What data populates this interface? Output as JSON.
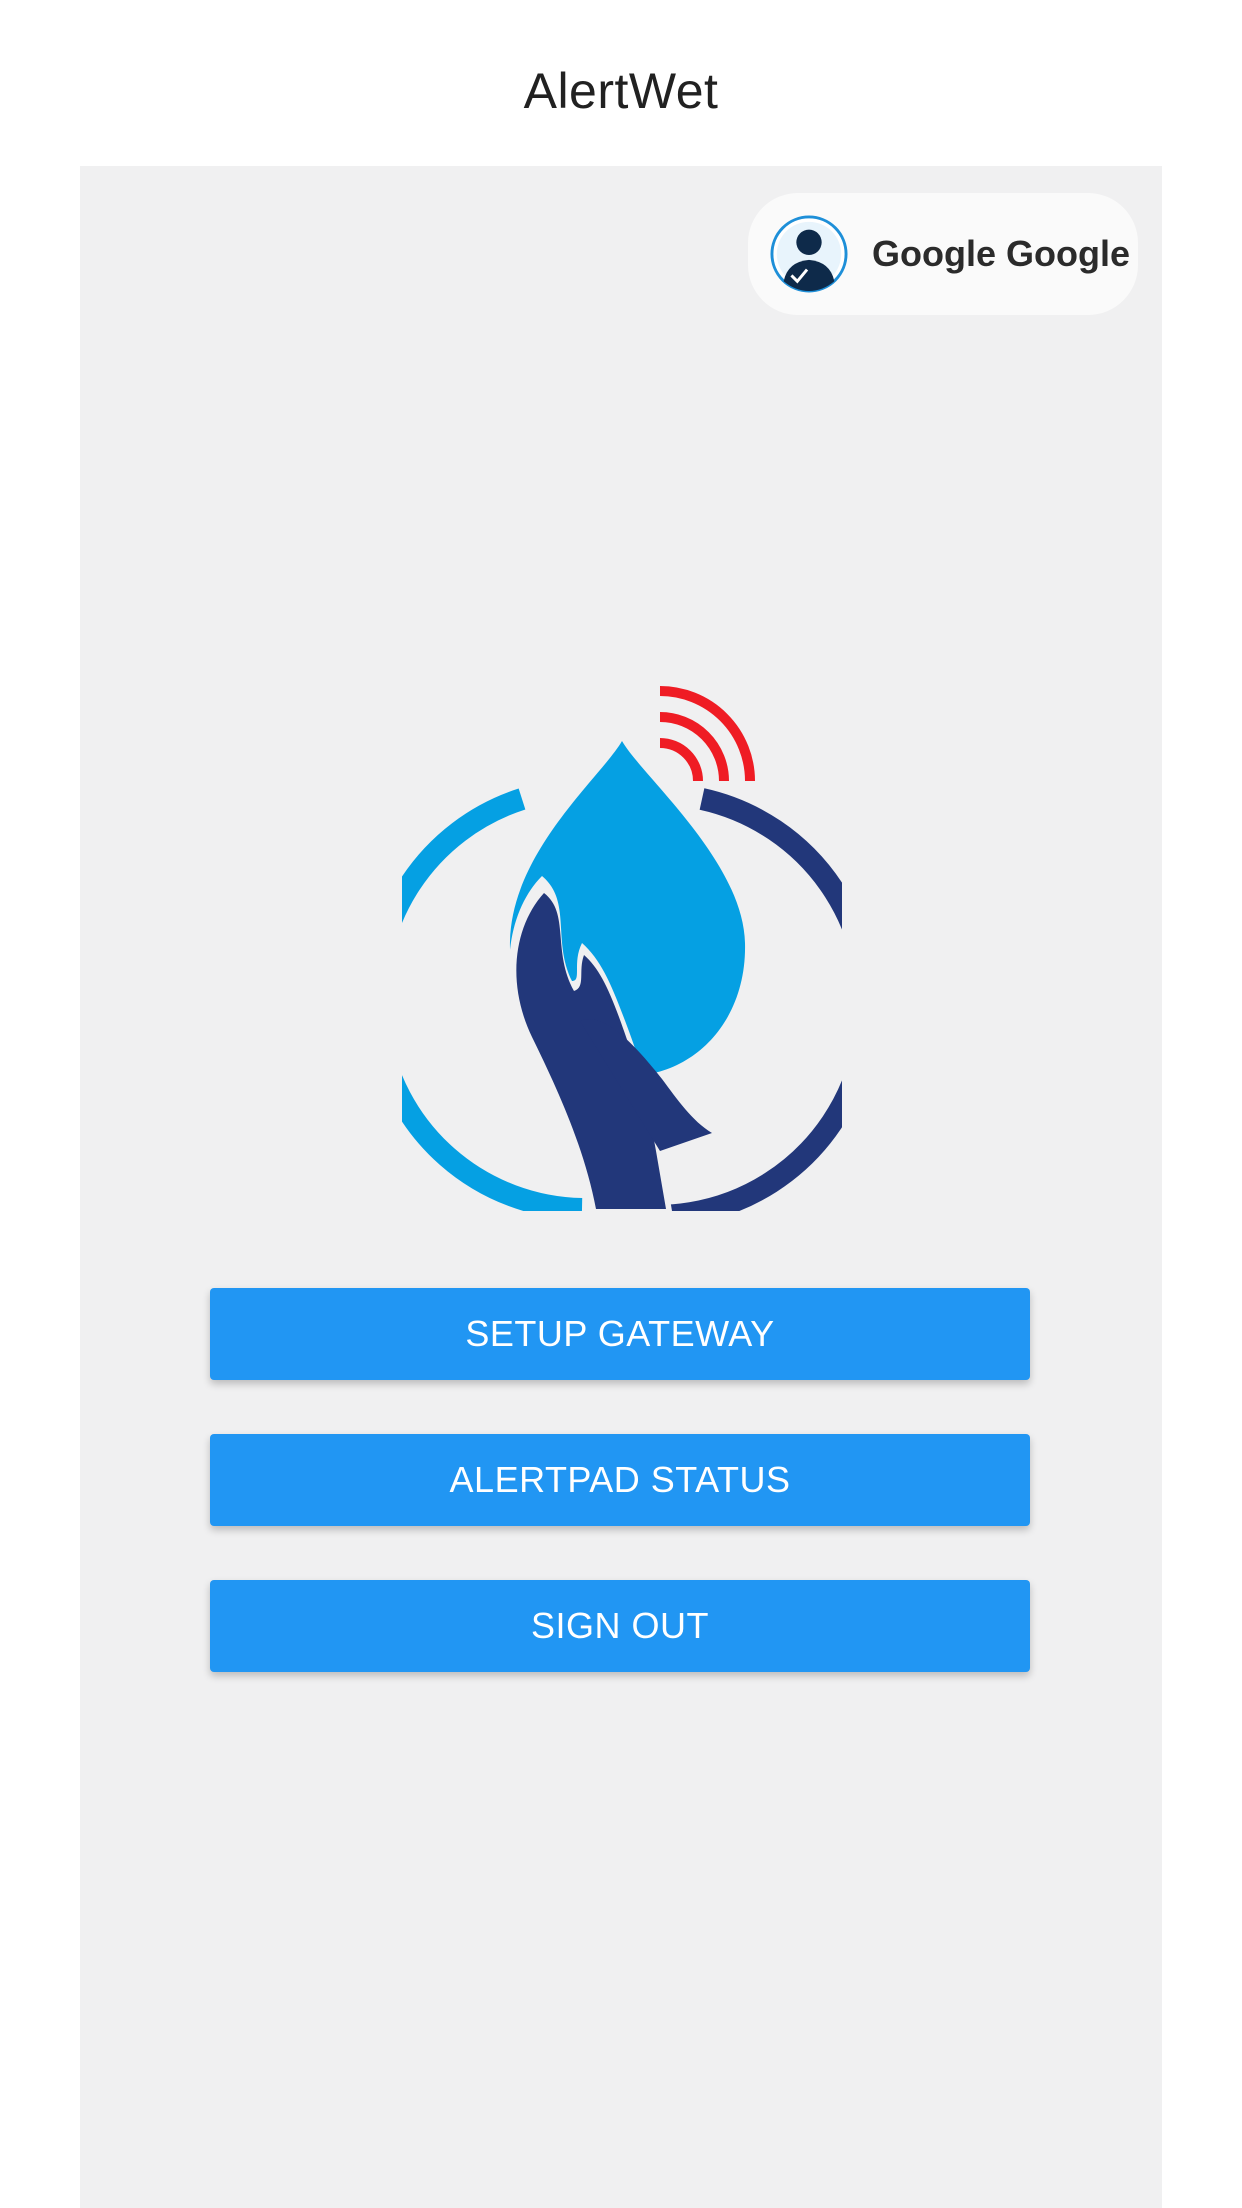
{
  "app": {
    "title": "AlertWet"
  },
  "user": {
    "name": "Google Google",
    "avatar_icon": "user-avatar-icon"
  },
  "logo": {
    "icon": "water-drop-hand-wifi-logo",
    "colors": {
      "drop": "#05a0e3",
      "hand": "#22377a",
      "signal": "#ef1c24"
    }
  },
  "buttons": {
    "setup_gateway": "SETUP GATEWAY",
    "alertpad_status": "ALERTPAD STATUS",
    "sign_out": "SIGN OUT"
  },
  "theme": {
    "accent": "#2196f3",
    "background": "#f0f0f1"
  }
}
